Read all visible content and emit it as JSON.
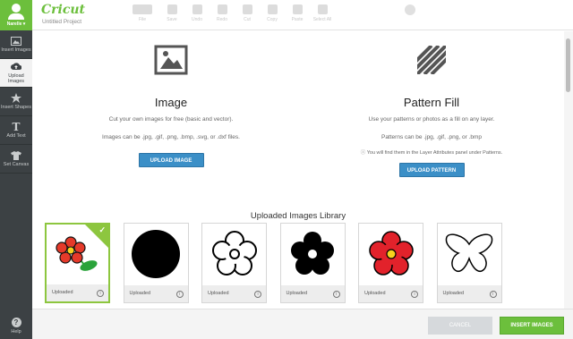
{
  "sidebar": {
    "user_name": "Narelle",
    "items": [
      {
        "label": "Insert Images",
        "icon": "image-icon",
        "active": false
      },
      {
        "label": "Upload Images",
        "icon": "cloud-upload-icon",
        "active": true
      },
      {
        "label": "Insert Shapes",
        "icon": "shapes-icon",
        "active": false
      },
      {
        "label": "Add Text",
        "icon": "text-icon",
        "active": false
      },
      {
        "label": "Set Canvas",
        "icon": "shirt-icon",
        "active": false
      }
    ],
    "help_label": "Help"
  },
  "header": {
    "logo": "Cricut",
    "project_name": "Untitled Project",
    "toolbar": [
      "File",
      "Save",
      "Undo",
      "Redo",
      "Cut",
      "Copy",
      "Paste",
      "Select All"
    ]
  },
  "image_panel": {
    "title": "Image",
    "line1": "Cut your own images for free (basic and vector).",
    "line2": "Images can be .jpg, .gif, .png, .bmp, .svg, or .dxf files.",
    "button": "UPLOAD IMAGE"
  },
  "pattern_panel": {
    "title": "Pattern Fill",
    "line1": "Use your patterns or photos as a fill on any layer.",
    "line2": "Patterns can be .jpg, .gif, .png, or .bmp",
    "note": "You will find them in the Layer Attributes panel under Patterns.",
    "button": "UPLOAD PATTERN"
  },
  "library": {
    "title": "Uploaded Images Library",
    "items": [
      {
        "label": "Uploaded",
        "art": "red-flower-color",
        "selected": true
      },
      {
        "label": "Uploaded",
        "art": "black-circle",
        "selected": false
      },
      {
        "label": "Uploaded",
        "art": "flower-outline",
        "selected": false
      },
      {
        "label": "Uploaded",
        "art": "black-flower",
        "selected": false
      },
      {
        "label": "Uploaded",
        "art": "red-flower",
        "selected": false
      },
      {
        "label": "Uploaded",
        "art": "butterfly-outline",
        "selected": false
      }
    ]
  },
  "footer": {
    "cancel": "CANCEL",
    "insert": "INSERT IMAGES"
  },
  "colors": {
    "accent_green": "#6cbf3c",
    "button_blue": "#3b8fc7",
    "sidebar": "#3c4144"
  }
}
